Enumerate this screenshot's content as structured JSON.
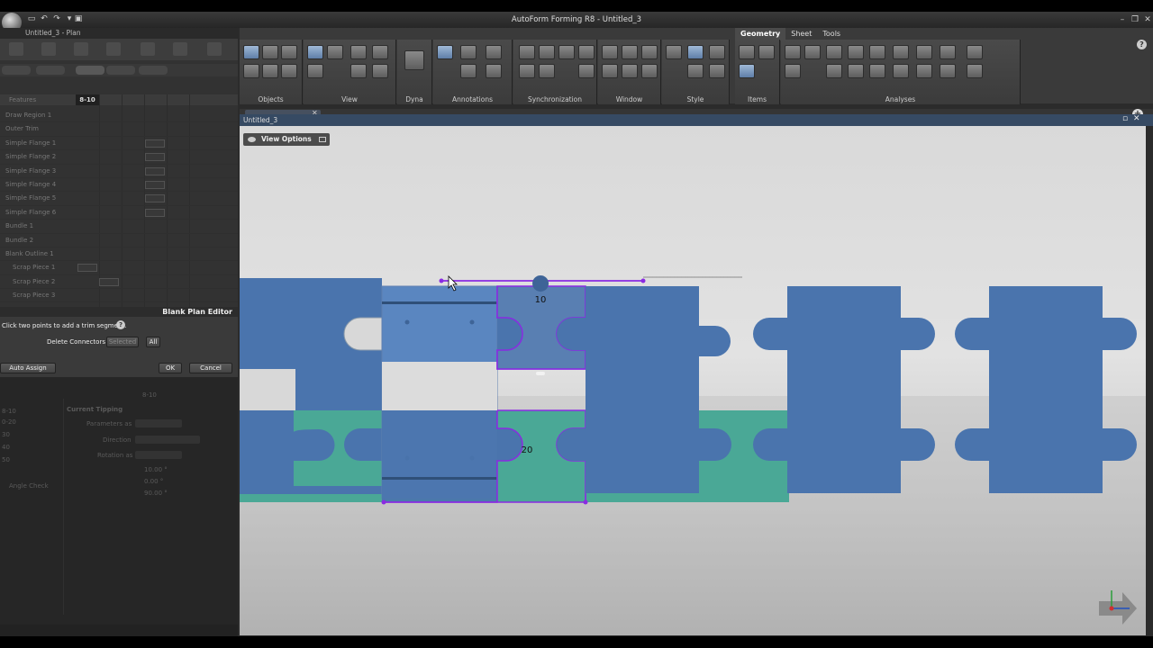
{
  "app": {
    "title": "AutoForm Forming R8 - Untitled_3"
  },
  "ribbon": {
    "tabs": [
      "Geometry",
      "Sheet",
      "Tools"
    ],
    "active_tab": "Geometry",
    "groups": [
      "Objects",
      "View",
      "Dyna",
      "Annotations",
      "Synchronization",
      "Window",
      "Style",
      "Items",
      "Analyses"
    ]
  },
  "left_panel": {
    "title": "Untitled_3 - Plan",
    "grid_header": {
      "name_col": "Features",
      "selected_col": "8-10"
    },
    "tree": [
      {
        "label": "Draw Region 1",
        "mark": false,
        "indent": 0
      },
      {
        "label": "Outer Trim",
        "mark": false,
        "indent": 0
      },
      {
        "label": "Simple Flange 1",
        "mark": true,
        "indent": 0
      },
      {
        "label": "Simple Flange 2",
        "mark": true,
        "indent": 0
      },
      {
        "label": "Simple Flange 3",
        "mark": true,
        "indent": 0
      },
      {
        "label": "Simple Flange 4",
        "mark": true,
        "indent": 0
      },
      {
        "label": "Simple Flange 5",
        "mark": true,
        "indent": 0
      },
      {
        "label": "Simple Flange 6",
        "mark": true,
        "indent": 0
      },
      {
        "label": "Bundle 1",
        "mark": false,
        "indent": 0
      },
      {
        "label": "Bundle 2",
        "mark": false,
        "indent": 0
      },
      {
        "label": "Blank Outline 1",
        "mark": false,
        "indent": 0
      },
      {
        "label": "Scrap Piece 1",
        "mark": false,
        "indent": 1
      },
      {
        "label": "Scrap Piece 2",
        "mark": false,
        "indent": 1
      },
      {
        "label": "Scrap Piece 3",
        "mark": false,
        "indent": 1
      }
    ]
  },
  "blank_plan_editor": {
    "title": "Blank Plan Editor",
    "hint": "Click two points to add a trim segment.",
    "delete_label": "Delete Connectors",
    "selected_btn": "Selected",
    "all_btn": "All",
    "auto_assign_btn": "Auto Assign",
    "ok_btn": "OK",
    "cancel_btn": "Cancel"
  },
  "lower_panel": {
    "section": "8-10",
    "heading": "Current Tipping",
    "fields": [
      "Parameters as",
      "Direction",
      "Rotation as"
    ],
    "row_labels": [
      "8-10",
      "0-20",
      "30",
      "40",
      "50"
    ],
    "angle_check": "Angle Check",
    "values": [
      "10.00 °",
      "0.00 °",
      "90.00 °"
    ]
  },
  "viewport": {
    "tab_title": "Untitled_3",
    "window_title": "Untitled_3",
    "view_options": "View Options",
    "labels": [
      "10",
      "20"
    ]
  },
  "colors": {
    "part_blue": "#4a74ad",
    "part_blue_light": "#5a86c0",
    "part_teal": "#4aa896",
    "trim_purple": "#8a2be2",
    "ribbon_bg": "#3a3a3a",
    "viewport_title": "#364a63"
  }
}
